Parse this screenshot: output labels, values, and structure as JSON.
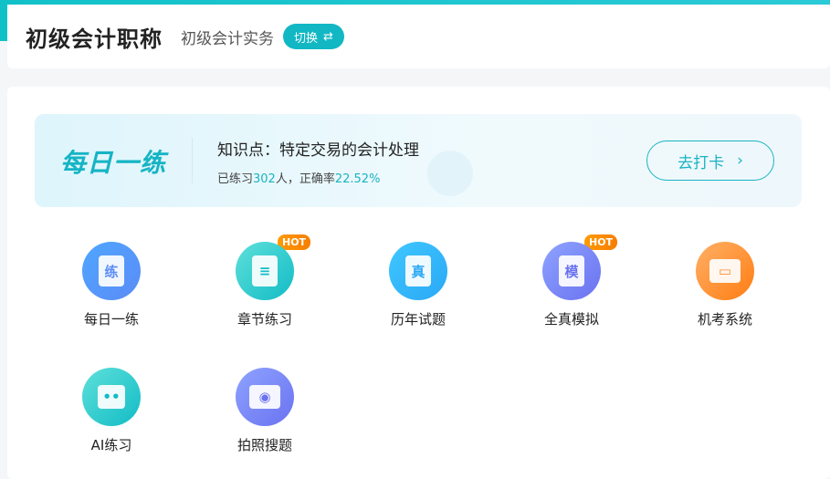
{
  "header": {
    "title": "初级会计职称",
    "subject": "初级会计实务",
    "switch_label": "切换",
    "switch_icon": "⇄"
  },
  "banner": {
    "logo": "每日一练",
    "topic": "知识点：特定交易的会计处理",
    "stats_prefix": "已练习",
    "count": "302",
    "stats_mid": "人，正确率",
    "rate": "22.52%",
    "button": "去打卡",
    "button_icon": "›"
  },
  "items": [
    {
      "label": "每日一练",
      "glyph": "练",
      "hot": ""
    },
    {
      "label": "章节练习",
      "glyph": "≡",
      "hot": "HOT"
    },
    {
      "label": "历年试题",
      "glyph": "真",
      "hot": ""
    },
    {
      "label": "全真模拟",
      "glyph": "模",
      "hot": "HOT"
    },
    {
      "label": "机考系统",
      "glyph": "▭",
      "hot": ""
    },
    {
      "label": "AI练习",
      "glyph": "••",
      "hot": ""
    },
    {
      "label": "拍照搜题",
      "glyph": "◉",
      "hot": ""
    }
  ]
}
